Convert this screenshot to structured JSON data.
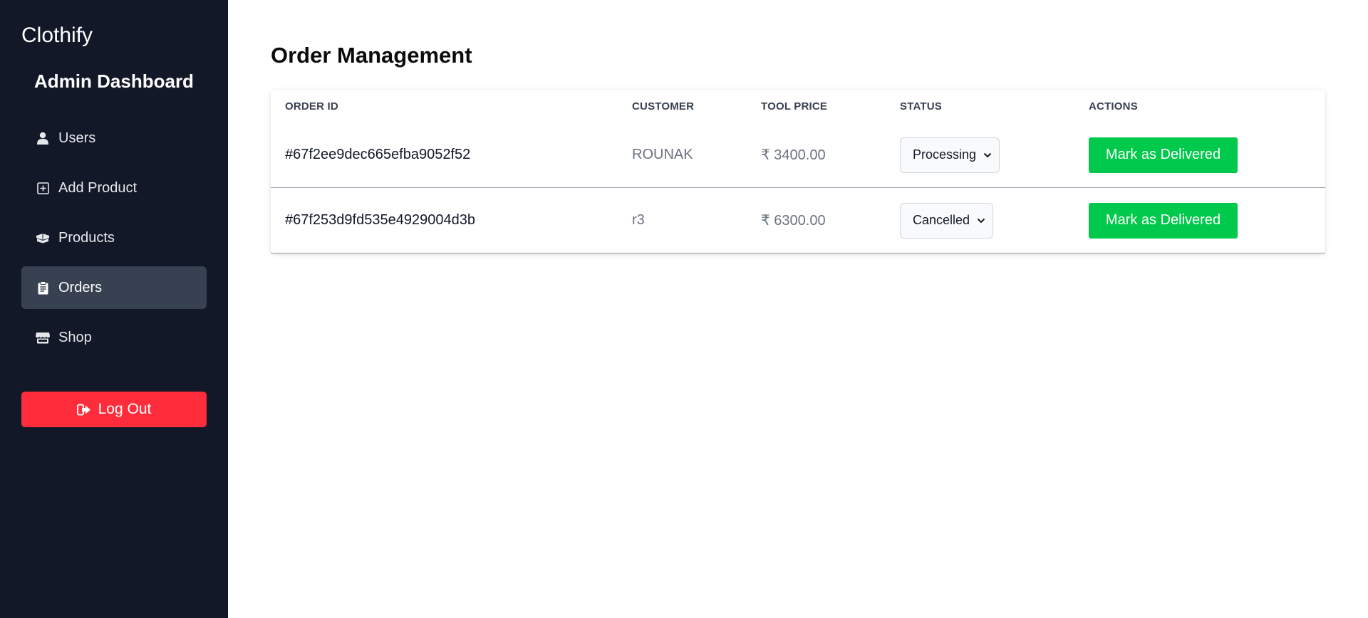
{
  "sidebar": {
    "brand": "Clothify",
    "subtitle": "Admin Dashboard",
    "items": [
      {
        "label": "Users",
        "icon": "user-icon"
      },
      {
        "label": "Add Product",
        "icon": "plus-square-icon"
      },
      {
        "label": "Products",
        "icon": "boxes-icon"
      },
      {
        "label": "Orders",
        "icon": "clipboard-icon",
        "active": true
      },
      {
        "label": "Shop",
        "icon": "store-icon"
      }
    ],
    "logout_label": "Log Out"
  },
  "main": {
    "title": "Order Management",
    "columns": [
      "ORDER ID",
      "CUSTOMER",
      "TOOL PRICE",
      "STATUS",
      "ACTIONS"
    ],
    "rows": [
      {
        "order_id": "#67f2ee9dec665efba9052f52",
        "customer": "ROUNAK",
        "price": "₹ 3400.00",
        "status": "Processing",
        "action": "Mark as Delivered"
      },
      {
        "order_id": "#67f253d9fd535e4929004d3b",
        "customer": "r3",
        "price": "₹ 6300.00",
        "status": "Cancelled",
        "action": "Mark as Delivered"
      }
    ]
  },
  "colors": {
    "sidebar_bg": "#121827",
    "active_item_bg": "#374151",
    "logout_bg": "#ff2d3b",
    "deliver_btn_bg": "#00c94b"
  }
}
